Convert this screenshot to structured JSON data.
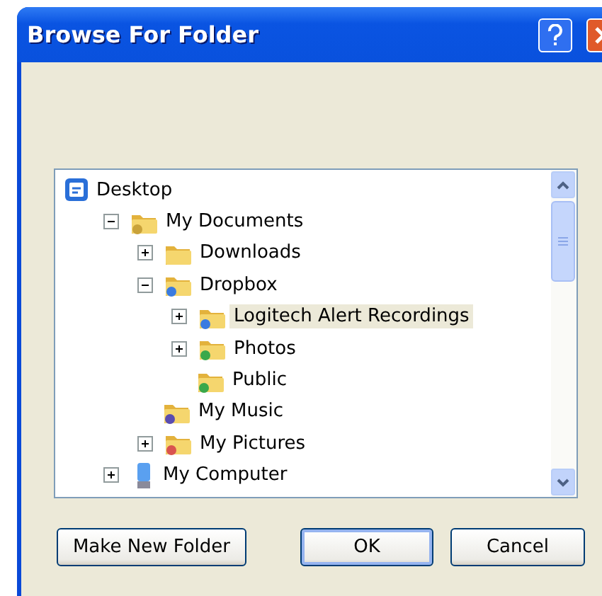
{
  "window": {
    "title": "Browse For Folder"
  },
  "tree": [
    {
      "label": "Desktop",
      "kind": "desktop",
      "selected": false,
      "children": [
        {
          "label": "My Documents",
          "kind": "documents",
          "expanded": true,
          "selected": false,
          "children": [
            {
              "label": "Downloads",
              "kind": "folder",
              "expanded": false,
              "selected": false
            },
            {
              "label": "Dropbox",
              "kind": "synced",
              "expanded": true,
              "selected": false,
              "children": [
                {
                  "label": "Logitech Alert Recordings",
                  "kind": "synced",
                  "expanded": false,
                  "selected": true
                },
                {
                  "label": "Photos",
                  "kind": "shared",
                  "expanded": false,
                  "selected": false
                },
                {
                  "label": "Public",
                  "kind": "shared",
                  "selected": false
                }
              ]
            },
            {
              "label": "My Music",
              "kind": "music",
              "selected": false
            },
            {
              "label": "My Pictures",
              "kind": "pictures",
              "expanded": false,
              "selected": false
            }
          ]
        },
        {
          "label": "My Computer",
          "kind": "computer",
          "expanded": false,
          "selected": false
        }
      ]
    }
  ],
  "buttons": [
    {
      "label": "Make New Folder",
      "kind": "secondary"
    },
    {
      "label": "OK",
      "kind": "default"
    },
    {
      "label": "Cancel",
      "kind": "secondary"
    }
  ]
}
